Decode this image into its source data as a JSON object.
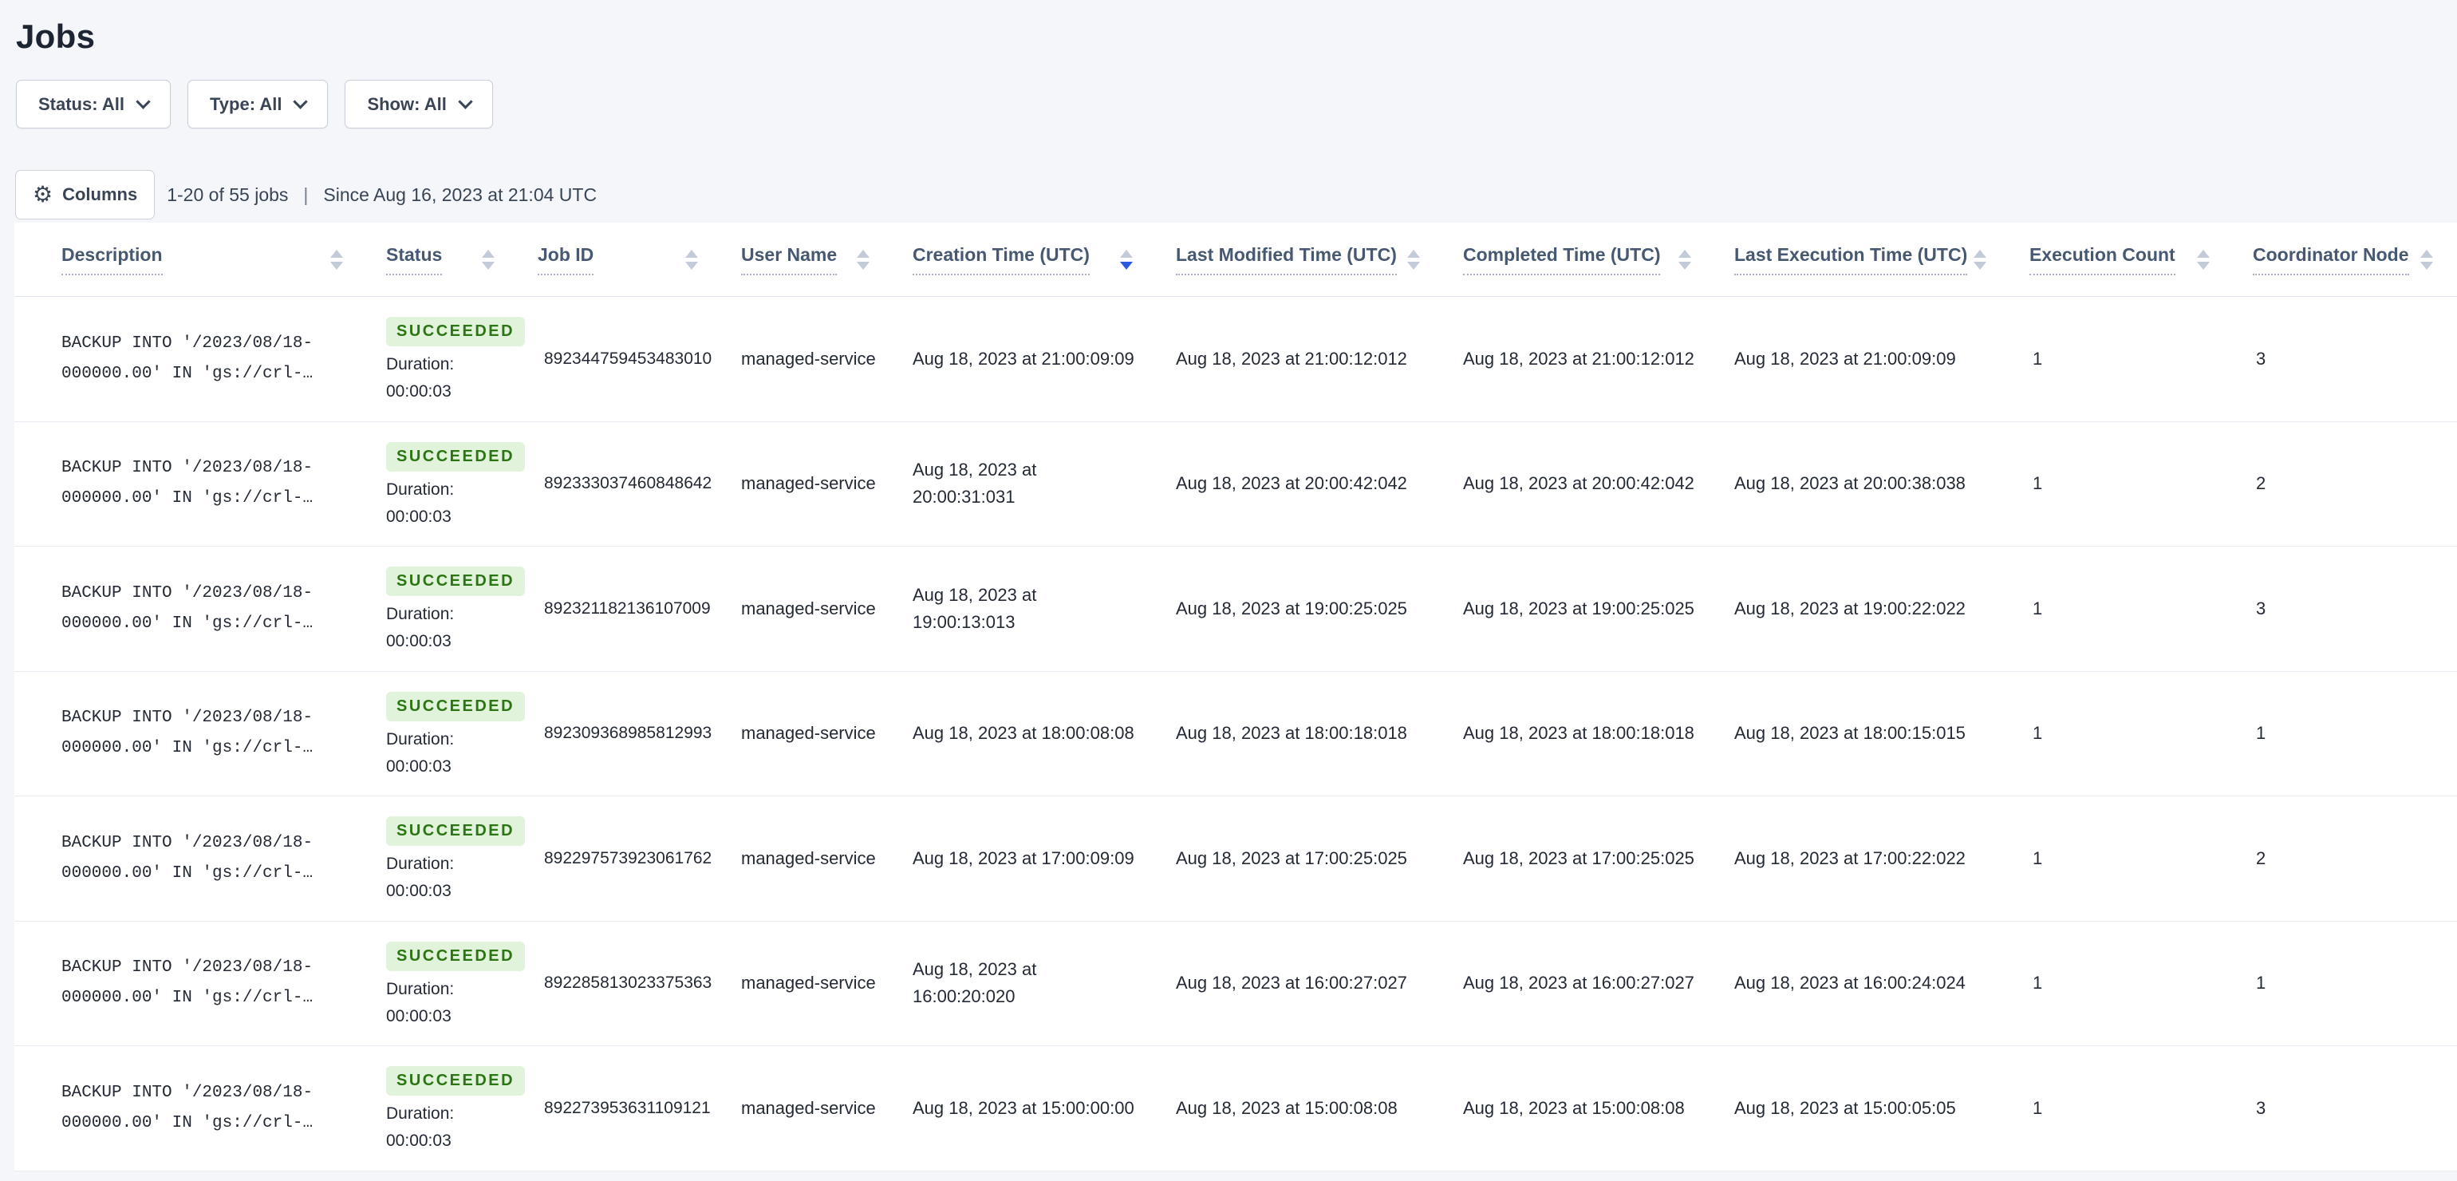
{
  "page_title": "Jobs",
  "filters": {
    "status": "Status: All",
    "type": "Type: All",
    "show": "Show: All"
  },
  "toolbar": {
    "columns_label": "Columns",
    "results_count": "1-20 of 55 jobs",
    "divider": "|",
    "since": "Since Aug 16, 2023 at 21:04 UTC"
  },
  "colors": {
    "accent_blue": "#2B59E0",
    "badge_bg": "#E1F3DA",
    "badge_text": "#2C7514",
    "page_bg": "#F4F6FA",
    "header_text": "#475872",
    "cell_text": "#242A35"
  },
  "table": {
    "columns": [
      {
        "label": "Description",
        "sort": "none"
      },
      {
        "label": "Status",
        "sort": "none"
      },
      {
        "label": "Job ID",
        "sort": "none"
      },
      {
        "label": "User Name",
        "sort": "none"
      },
      {
        "label": "Creation Time (UTC)",
        "sort": "desc"
      },
      {
        "label": "Last Modified Time (UTC)",
        "sort": "none"
      },
      {
        "label": "Completed Time (UTC)",
        "sort": "none"
      },
      {
        "label": "Last Execution Time (UTC)",
        "sort": "none"
      },
      {
        "label": "Execution Count",
        "sort": "none"
      },
      {
        "label": "Coordinator Node",
        "sort": "none"
      }
    ],
    "rows": [
      {
        "description_line1": "BACKUP INTO '/2023/08/18-",
        "description_line2": "000000.00' IN 'gs://crl-…",
        "status": "SUCCEEDED",
        "duration_label": "Duration:",
        "duration_value": "00:00:03",
        "job_id": "892344759453483010",
        "user_name": "managed-service",
        "creation_time": "Aug 18, 2023 at 21:00:09:09",
        "last_modified_time": "Aug 18, 2023 at 21:00:12:012",
        "completed_time": "Aug 18, 2023 at 21:00:12:012",
        "last_execution_time": "Aug 18, 2023 at 21:00:09:09",
        "execution_count": "1",
        "coordinator_node": "3"
      },
      {
        "description_line1": "BACKUP INTO '/2023/08/18-",
        "description_line2": "000000.00' IN 'gs://crl-…",
        "status": "SUCCEEDED",
        "duration_label": "Duration:",
        "duration_value": "00:00:03",
        "job_id": "892333037460848642",
        "user_name": "managed-service",
        "creation_time": "Aug 18, 2023 at 20:00:31:031",
        "last_modified_time": "Aug 18, 2023 at 20:00:42:042",
        "completed_time": "Aug 18, 2023 at 20:00:42:042",
        "last_execution_time": "Aug 18, 2023 at 20:00:38:038",
        "execution_count": "1",
        "coordinator_node": "2"
      },
      {
        "description_line1": "BACKUP INTO '/2023/08/18-",
        "description_line2": "000000.00' IN 'gs://crl-…",
        "status": "SUCCEEDED",
        "duration_label": "Duration:",
        "duration_value": "00:00:03",
        "job_id": "892321182136107009",
        "user_name": "managed-service",
        "creation_time": "Aug 18, 2023 at 19:00:13:013",
        "last_modified_time": "Aug 18, 2023 at 19:00:25:025",
        "completed_time": "Aug 18, 2023 at 19:00:25:025",
        "last_execution_time": "Aug 18, 2023 at 19:00:22:022",
        "execution_count": "1",
        "coordinator_node": "3"
      },
      {
        "description_line1": "BACKUP INTO '/2023/08/18-",
        "description_line2": "000000.00' IN 'gs://crl-…",
        "status": "SUCCEEDED",
        "duration_label": "Duration:",
        "duration_value": "00:00:03",
        "job_id": "892309368985812993",
        "user_name": "managed-service",
        "creation_time": "Aug 18, 2023 at 18:00:08:08",
        "last_modified_time": "Aug 18, 2023 at 18:00:18:018",
        "completed_time": "Aug 18, 2023 at 18:00:18:018",
        "last_execution_time": "Aug 18, 2023 at 18:00:15:015",
        "execution_count": "1",
        "coordinator_node": "1"
      },
      {
        "description_line1": "BACKUP INTO '/2023/08/18-",
        "description_line2": "000000.00' IN 'gs://crl-…",
        "status": "SUCCEEDED",
        "duration_label": "Duration:",
        "duration_value": "00:00:03",
        "job_id": "892297573923061762",
        "user_name": "managed-service",
        "creation_time": "Aug 18, 2023 at 17:00:09:09",
        "last_modified_time": "Aug 18, 2023 at 17:00:25:025",
        "completed_time": "Aug 18, 2023 at 17:00:25:025",
        "last_execution_time": "Aug 18, 2023 at 17:00:22:022",
        "execution_count": "1",
        "coordinator_node": "2"
      },
      {
        "description_line1": "BACKUP INTO '/2023/08/18-",
        "description_line2": "000000.00' IN 'gs://crl-…",
        "status": "SUCCEEDED",
        "duration_label": "Duration:",
        "duration_value": "00:00:03",
        "job_id": "892285813023375363",
        "user_name": "managed-service",
        "creation_time": "Aug 18, 2023 at 16:00:20:020",
        "last_modified_time": "Aug 18, 2023 at 16:00:27:027",
        "completed_time": "Aug 18, 2023 at 16:00:27:027",
        "last_execution_time": "Aug 18, 2023 at 16:00:24:024",
        "execution_count": "1",
        "coordinator_node": "1"
      },
      {
        "description_line1": "BACKUP INTO '/2023/08/18-",
        "description_line2": "000000.00' IN 'gs://crl-…",
        "status": "SUCCEEDED",
        "duration_label": "Duration:",
        "duration_value": "00:00:03",
        "job_id": "892273953631109121",
        "user_name": "managed-service",
        "creation_time": "Aug 18, 2023 at 15:00:00:00",
        "last_modified_time": "Aug 18, 2023 at 15:00:08:08",
        "completed_time": "Aug 18, 2023 at 15:00:08:08",
        "last_execution_time": "Aug 18, 2023 at 15:00:05:05",
        "execution_count": "1",
        "coordinator_node": "3"
      }
    ]
  }
}
